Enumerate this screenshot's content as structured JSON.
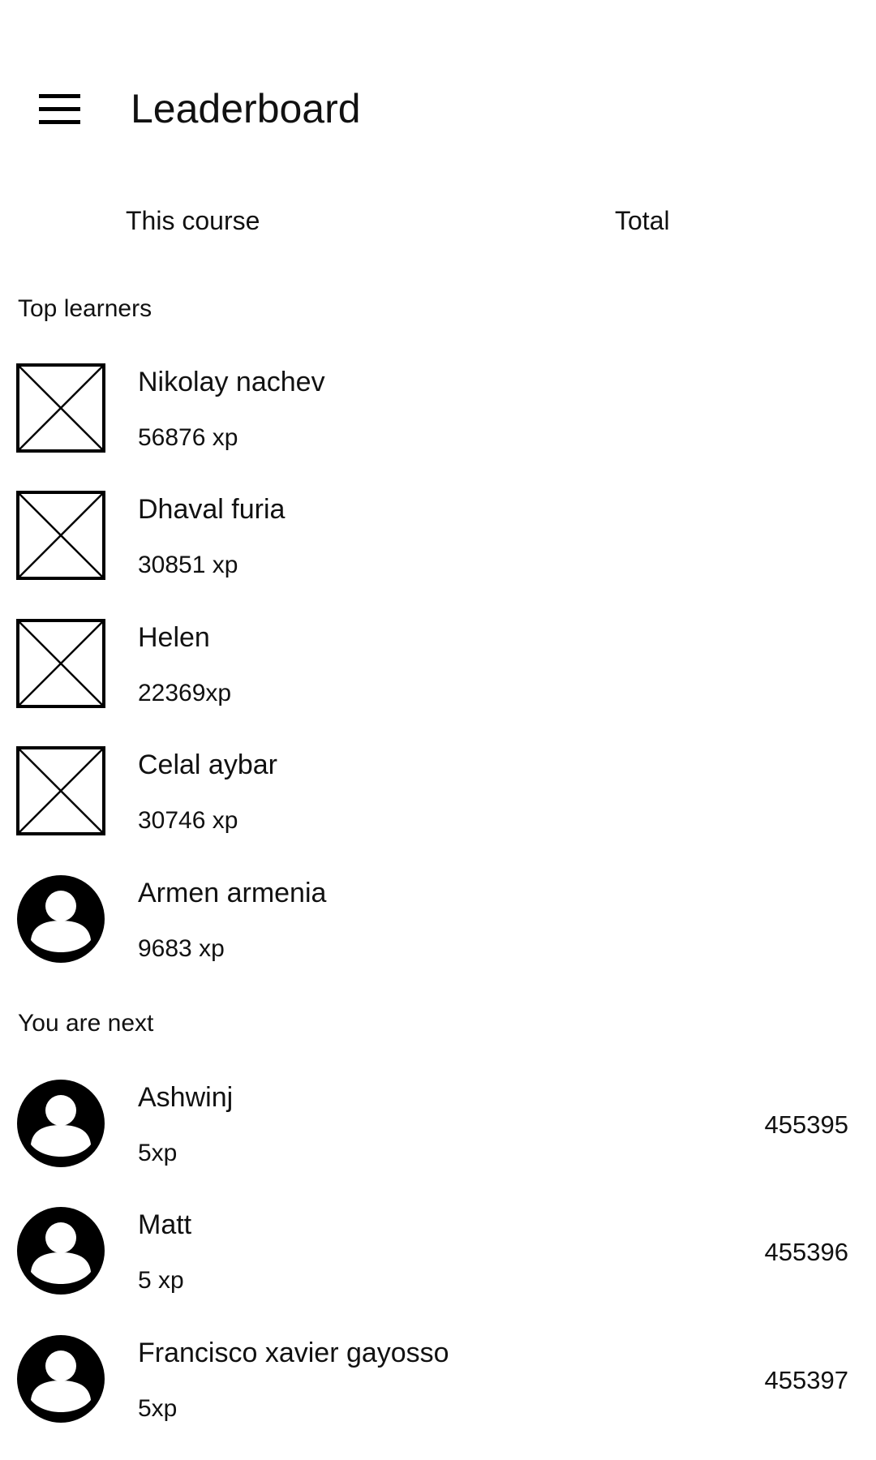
{
  "header": {
    "title": "Leaderboard",
    "menu_icon": "hamburger-menu-icon"
  },
  "tabs": [
    {
      "label": "This course"
    },
    {
      "label": "Total"
    }
  ],
  "sections": {
    "top_learners_label": "Top learners",
    "you_are_next_label": "You are next"
  },
  "top_learners": [
    {
      "name": "Nikolay nachev",
      "xp": "56876 xp",
      "avatar": "image-placeholder-icon"
    },
    {
      "name": "Dhaval furia",
      "xp": "30851 xp",
      "avatar": "image-placeholder-icon"
    },
    {
      "name": "Helen",
      "xp": "22369xp",
      "avatar": "image-placeholder-icon"
    },
    {
      "name": "Celal aybar",
      "xp": "30746 xp",
      "avatar": "image-placeholder-icon"
    },
    {
      "name": "Armen armenia",
      "xp": "9683 xp",
      "avatar": "user-avatar-icon"
    }
  ],
  "next_learners": [
    {
      "name": "Ashwinj",
      "xp": "5xp",
      "rank": "455395",
      "avatar": "user-avatar-icon"
    },
    {
      "name": "Matt",
      "xp": "5 xp",
      "rank": "455396",
      "avatar": "user-avatar-icon"
    },
    {
      "name": "Francisco xavier gayosso",
      "xp": "5xp",
      "rank": "455397",
      "avatar": "user-avatar-icon"
    }
  ]
}
